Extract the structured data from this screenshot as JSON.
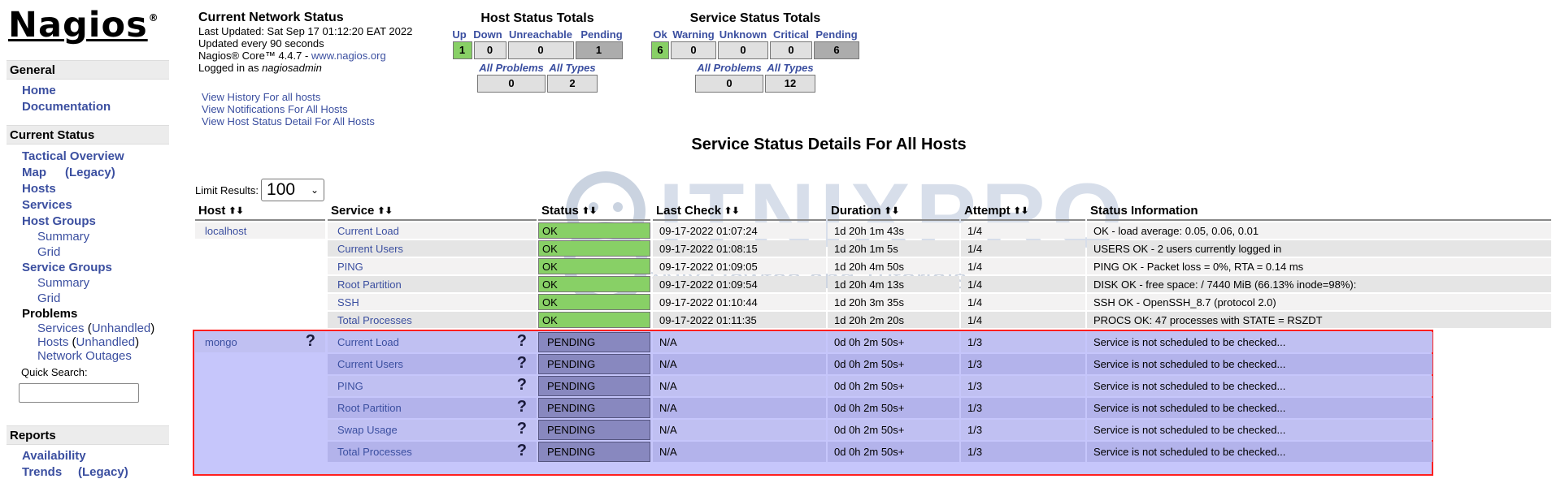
{
  "logo": {
    "text": "Nagios",
    "mark": "®"
  },
  "sidebar": {
    "general": {
      "header": "General",
      "items": [
        "Home",
        "Documentation"
      ]
    },
    "current_status": {
      "header": "Current Status",
      "tactical": "Tactical Overview",
      "map": "Map",
      "map_legacy": "(Legacy)",
      "hosts": "Hosts",
      "services": "Services",
      "host_groups": "Host Groups",
      "host_groups_summary": "Summary",
      "host_groups_grid": "Grid",
      "service_groups": "Service Groups",
      "service_groups_summary": "Summary",
      "service_groups_grid": "Grid",
      "problems": "Problems",
      "problems_services": "Services",
      "problems_services_unhandled": "Unhandled",
      "problems_hosts": "Hosts",
      "problems_hosts_unhandled": "Unhandled",
      "network_outages": "Network Outages",
      "quick_search_label": "Quick Search:",
      "quick_search_value": ""
    },
    "reports": {
      "header": "Reports",
      "availability": "Availability",
      "trends": "Trends",
      "trends_legacy": "(Legacy)"
    }
  },
  "network_status": {
    "title": "Current Network Status",
    "last_updated": "Last Updated: Sat Sep 17 01:12:20 EAT 2022",
    "update_interval": "Updated every 90 seconds",
    "version_prefix": "Nagios® Core™ 4.4.7 - ",
    "version_link": "www.nagios.org",
    "logged_in_prefix": "Logged in as ",
    "logged_in_user": "nagiosadmin",
    "links": [
      "View History For all hosts",
      "View Notifications For All Hosts",
      "View Host Status Detail For All Hosts"
    ]
  },
  "host_totals": {
    "title": "Host Status Totals",
    "headers": [
      "Up",
      "Down",
      "Unreachable",
      "Pending"
    ],
    "values": [
      "1",
      "0",
      "0",
      "1"
    ],
    "sub_headers": [
      "All Problems",
      "All Types"
    ],
    "sub_values": [
      "0",
      "2"
    ]
  },
  "service_totals": {
    "title": "Service Status Totals",
    "headers": [
      "Ok",
      "Warning",
      "Unknown",
      "Critical",
      "Pending"
    ],
    "values": [
      "6",
      "0",
      "0",
      "0",
      "6"
    ],
    "sub_headers": [
      "All Problems",
      "All Types"
    ],
    "sub_values": [
      "0",
      "12"
    ]
  },
  "page_heading": "Service Status Details For All Hosts",
  "limit": {
    "label": "Limit Results:",
    "value": "100"
  },
  "watermark": {
    "brand": "ITNIXPRO",
    "tagline": "*Nix Howtos and Tutorials"
  },
  "table": {
    "columns": [
      "Host",
      "Service",
      "Status",
      "Last Check",
      "Duration",
      "Attempt",
      "Status Information"
    ],
    "colors": {
      "ok": "#88d066",
      "pending": "#8888bf",
      "pending_bg": "#c6c6fb",
      "highlight_border": "#ff1f1f"
    },
    "hosts": [
      {
        "name": "localhost",
        "services": [
          {
            "service": "Current Load",
            "status": "OK",
            "last_check": "09-17-2022 01:07:24",
            "duration": "1d 20h 1m 43s",
            "attempt": "1/4",
            "info": "OK - load average: 0.05, 0.06, 0.01"
          },
          {
            "service": "Current Users",
            "status": "OK",
            "last_check": "09-17-2022 01:08:15",
            "duration": "1d 20h 1m 5s",
            "attempt": "1/4",
            "info": "USERS OK - 2 users currently logged in"
          },
          {
            "service": "PING",
            "status": "OK",
            "last_check": "09-17-2022 01:09:05",
            "duration": "1d 20h 4m 50s",
            "attempt": "1/4",
            "info": "PING OK - Packet loss = 0%, RTA = 0.14 ms"
          },
          {
            "service": "Root Partition",
            "status": "OK",
            "last_check": "09-17-2022 01:09:54",
            "duration": "1d 20h 4m 13s",
            "attempt": "1/4",
            "info": "DISK OK - free space: / 7440 MiB (66.13% inode=98%):"
          },
          {
            "service": "SSH",
            "status": "OK",
            "last_check": "09-17-2022 01:10:44",
            "duration": "1d 20h 3m 35s",
            "attempt": "1/4",
            "info": "SSH OK - OpenSSH_8.7 (protocol 2.0)"
          },
          {
            "service": "Total Processes",
            "status": "OK",
            "last_check": "09-17-2022 01:11:35",
            "duration": "1d 20h 2m 20s",
            "attempt": "1/4",
            "info": "PROCS OK: 47 processes with STATE = RSZDT"
          }
        ]
      },
      {
        "name": "mongo",
        "icon": "?",
        "services": [
          {
            "service": "Current Load",
            "status": "PENDING",
            "last_check": "N/A",
            "duration": "0d 0h 2m 50s+",
            "attempt": "1/3",
            "info": "Service is not scheduled to be checked..."
          },
          {
            "service": "Current Users",
            "status": "PENDING",
            "last_check": "N/A",
            "duration": "0d 0h 2m 50s+",
            "attempt": "1/3",
            "info": "Service is not scheduled to be checked..."
          },
          {
            "service": "PING",
            "status": "PENDING",
            "last_check": "N/A",
            "duration": "0d 0h 2m 50s+",
            "attempt": "1/3",
            "info": "Service is not scheduled to be checked..."
          },
          {
            "service": "Root Partition",
            "status": "PENDING",
            "last_check": "N/A",
            "duration": "0d 0h 2m 50s+",
            "attempt": "1/3",
            "info": "Service is not scheduled to be checked..."
          },
          {
            "service": "Swap Usage",
            "status": "PENDING",
            "last_check": "N/A",
            "duration": "0d 0h 2m 50s+",
            "attempt": "1/3",
            "info": "Service is not scheduled to be checked..."
          },
          {
            "service": "Total Processes",
            "status": "PENDING",
            "last_check": "N/A",
            "duration": "0d 0h 2m 50s+",
            "attempt": "1/3",
            "info": "Service is not scheduled to be checked..."
          }
        ]
      }
    ]
  }
}
